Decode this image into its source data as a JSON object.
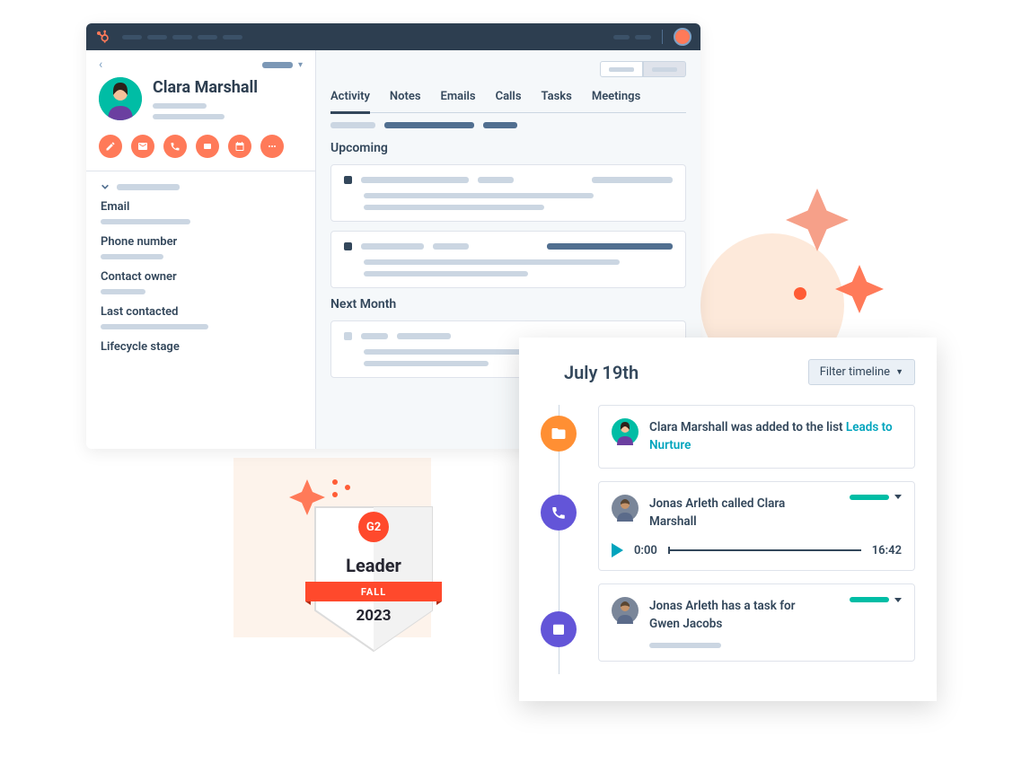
{
  "contact": {
    "name": "Clara Marshall",
    "fields": [
      {
        "label": "Email"
      },
      {
        "label": "Phone number"
      },
      {
        "label": "Contact owner"
      },
      {
        "label": "Last contacted"
      },
      {
        "label": "Lifecycle stage"
      }
    ]
  },
  "tabs": {
    "items": [
      "Activity",
      "Notes",
      "Emails",
      "Calls",
      "Tasks",
      "Meetings"
    ],
    "active": 0
  },
  "sections": {
    "upcoming": "Upcoming",
    "next_month": "Next Month"
  },
  "timeline": {
    "date": "July 19th",
    "filter_label": "Filter timeline",
    "items": [
      {
        "icon": "folder",
        "text_prefix": "Clara Marshall was added to the list ",
        "link": "Leads to Nurture",
        "avatar_color": "#00bda5"
      },
      {
        "icon": "phone",
        "text_prefix": "Jonas Arleth called Clara Marshall",
        "link": "",
        "avatar_color": "#b58863",
        "audio": {
          "start": "0:00",
          "end": "16:42"
        }
      },
      {
        "icon": "task",
        "text_prefix": "Jonas Arleth has a task for Gwen Jacobs",
        "link": "",
        "avatar_color": "#b58863"
      }
    ]
  },
  "badge": {
    "title": "Leader",
    "ribbon": "FALL",
    "year": "2023",
    "g2": "G2"
  }
}
